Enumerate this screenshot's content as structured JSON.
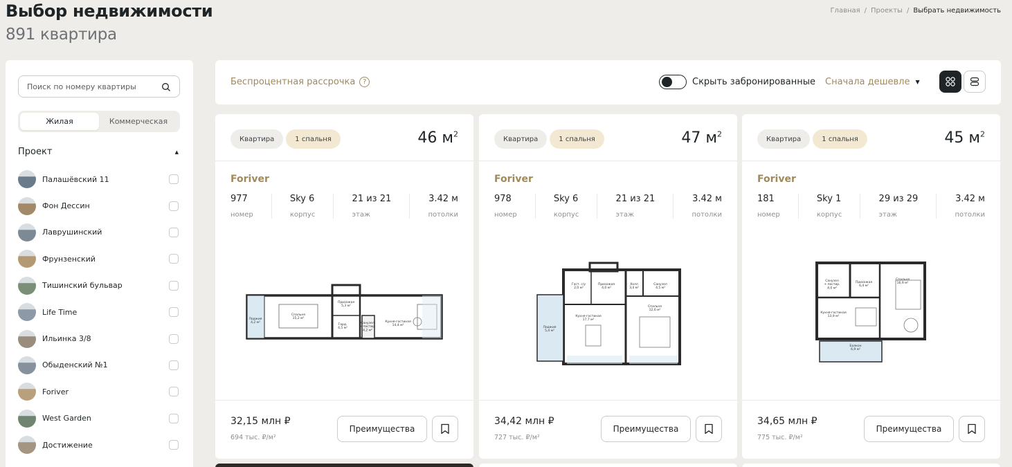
{
  "header": {
    "title": "Выбор недвижимости",
    "subtitle": "891 квартира"
  },
  "breadcrumb": [
    "Главная",
    "/",
    "Проекты",
    "/",
    "Выбрать недвижимость"
  ],
  "sidebar": {
    "search_placeholder": "Поиск по номеру квартиры",
    "tabs": [
      "Жилая",
      "Коммерческая"
    ],
    "project_label": "Проект",
    "projects": [
      "Палашёвский 11",
      "Фон Дессин",
      "Лаврушинский",
      "Фрунзенский",
      "Тишинский бульвар",
      "Life Time",
      "Ильинка 3/8",
      "Обыденский №1",
      "Foriver",
      "West Garden",
      "Достижение"
    ]
  },
  "toolbar": {
    "installment": "Беспроцентная рассрочка",
    "hide_booked": "Скрыть забронированные",
    "sort": "Сначала дешевле"
  },
  "cards": [
    {
      "type": "Квартира",
      "rooms": "1 спальня",
      "area": "46 м",
      "area_sup": "2",
      "project": "Foriver",
      "number": "977",
      "number_l": "номер",
      "building": "Sky 6",
      "building_l": "корпус",
      "floor": "21 из 21",
      "floor_l": "этаж",
      "ceiling": "3.42 м",
      "ceiling_l": "потолки",
      "price": "32,15 млн ₽",
      "ppm": "694 тыс. ₽/м²",
      "adv": "Преимущества"
    },
    {
      "type": "Квартира",
      "rooms": "1 спальня",
      "area": "47 м",
      "area_sup": "2",
      "project": "Foriver",
      "number": "978",
      "number_l": "номер",
      "building": "Sky 6",
      "building_l": "корпус",
      "floor": "21 из 21",
      "floor_l": "этаж",
      "ceiling": "3.42 м",
      "ceiling_l": "потолки",
      "price": "34,42 млн ₽",
      "ppm": "727 тыс. ₽/м²",
      "adv": "Преимущества"
    },
    {
      "type": "Квартира",
      "rooms": "1 спальня",
      "area": "45 м",
      "area_sup": "2",
      "project": "Foriver",
      "number": "181",
      "number_l": "номер",
      "building": "Sky 1",
      "building_l": "корпус",
      "floor": "29 из 29",
      "floor_l": "этаж",
      "ceiling": "3.42 м",
      "ceiling_l": "потолки",
      "price": "34,65 млн ₽",
      "ppm": "775 тыс. ₽/м²",
      "adv": "Преимущества"
    }
  ],
  "plans": {
    "p1": [
      "Лоджия\n4,2 м²",
      "Спальня\n15,2 м²",
      "Прихожая\n5,3 м²",
      "Гард.\n4,5 м²",
      "Санузел\n+ постир.\n4,2 м²",
      "Кухня-гостиная\n14,4 м²"
    ],
    "p2": [
      "Гост. с/у\n2,0 м²",
      "Прихожая\n4,0 м²",
      "Холл\n3,4 м²",
      "Санузел\n4,5 м²",
      "Кухня-гостиная\n17,7 м²",
      "Лоджия\n5,4 м²",
      "Спальня\n12,6 м²"
    ],
    "p3": [
      "Санузел\n+ постир.\n4,0 м²",
      "Прихожая\n6,4 м²",
      "Спальня\n16,9 м²",
      "Кухня-гостиная\n13,9 м²",
      "Балкон\n6,9 м²"
    ]
  },
  "colors": {
    "accent": "#a08a5b",
    "dark": "#1f2427",
    "bg": "#efede9",
    "tag_yellow": "#f3e9d2"
  }
}
